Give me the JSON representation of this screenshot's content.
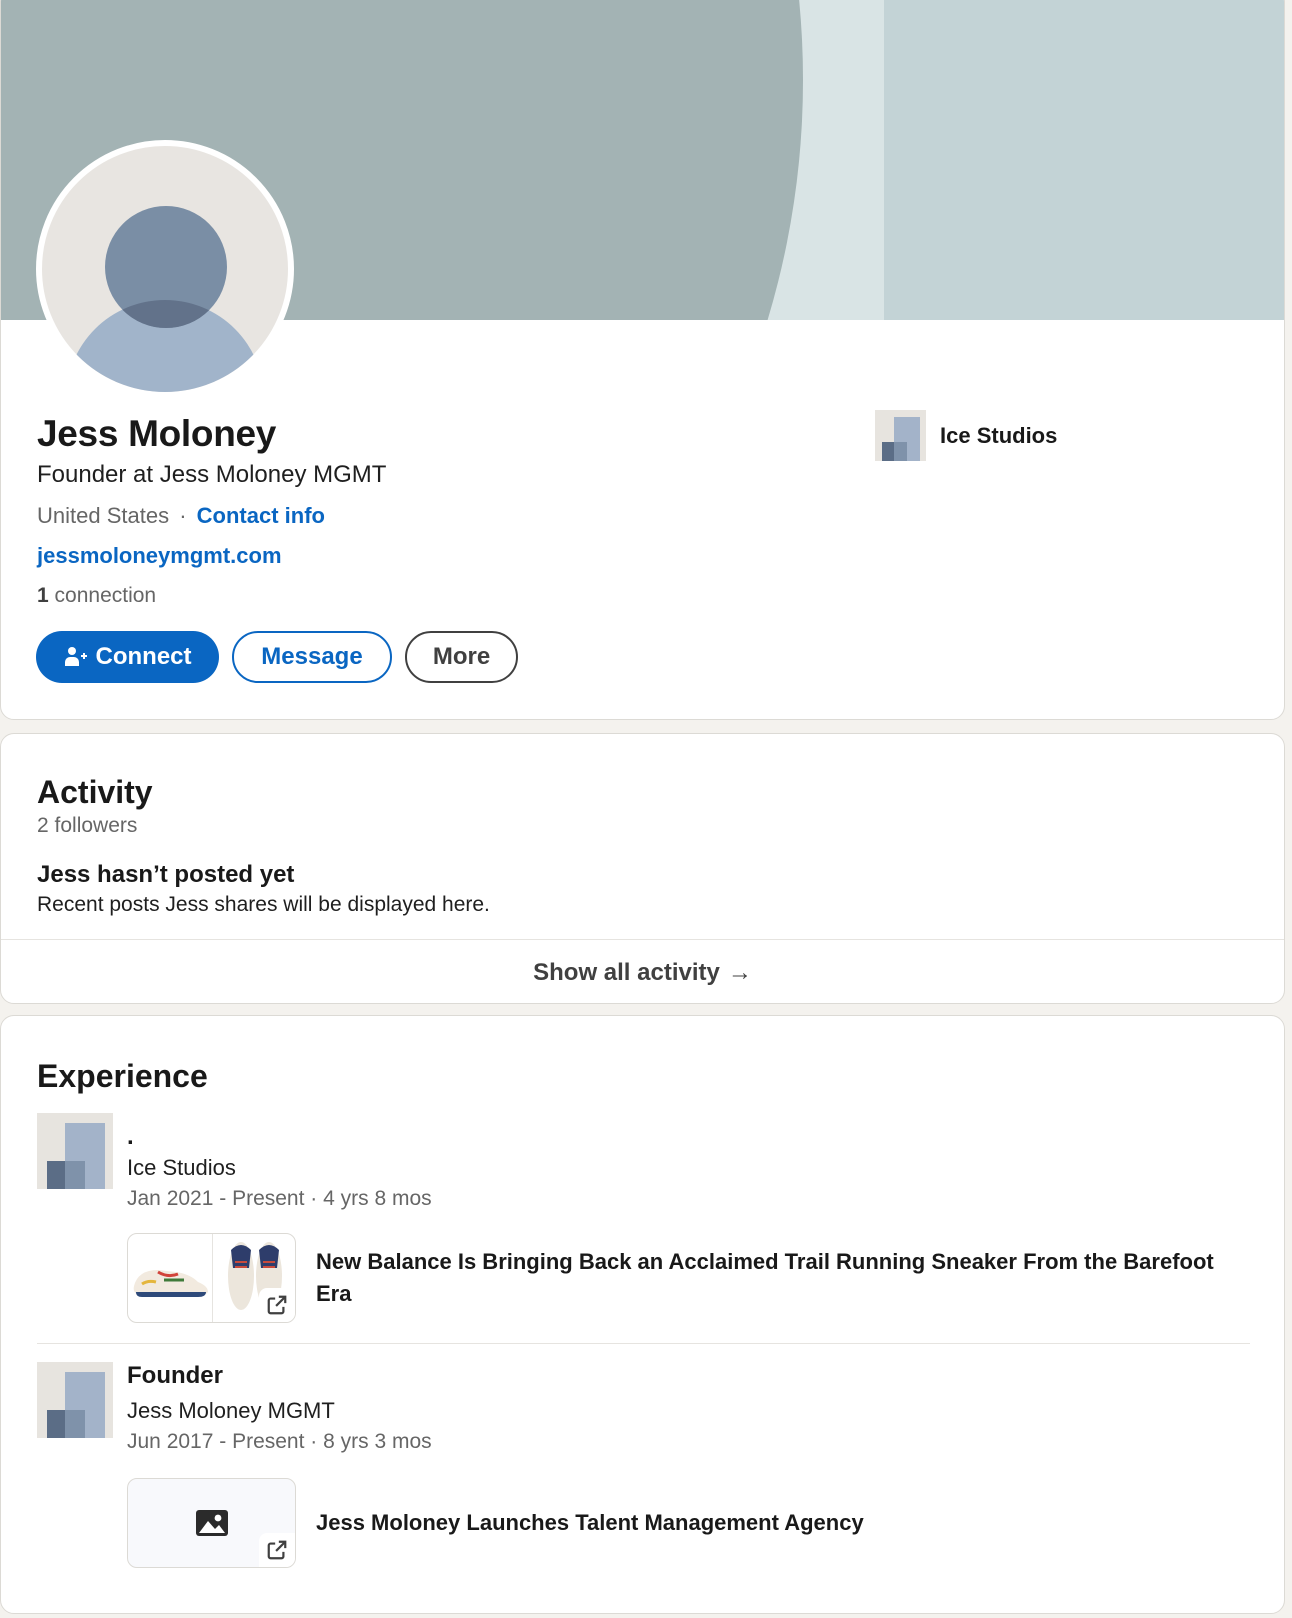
{
  "profile": {
    "name": "Jess Moloney",
    "headline": "Founder at Jess Moloney MGMT",
    "location": "United States",
    "separator": "·",
    "contact_info_label": "Contact info",
    "website": "jessmoloneymgmt.com",
    "connections_count": "1",
    "connections_label": "connection",
    "current_company": "Ice Studios"
  },
  "actions": {
    "connect_label": "Connect",
    "message_label": "Message",
    "more_label": "More"
  },
  "activity": {
    "title": "Activity",
    "followers": "2 followers",
    "empty_title": "Jess hasn’t posted yet",
    "empty_subtitle": "Recent posts Jess shares will be displayed here.",
    "show_all_label": "Show all activity",
    "show_all_arrow": "→"
  },
  "experience": {
    "title": "Experience",
    "items": [
      {
        "title": ".",
        "company": "Ice Studios",
        "dates": "Jan 2021 - Present · 4 yrs 8 mos",
        "media_title": "New Balance Is Bringing Back an Acclaimed Trail Running Sneaker From the Barefoot Era"
      },
      {
        "title": "Founder",
        "company": "Jess Moloney MGMT",
        "dates": "Jun 2017 - Present · 8 yrs 3 mos",
        "media_title": "Jess Moloney Launches Talent Management Agency"
      }
    ]
  },
  "colors": {
    "brand_blue": "#0a66c2",
    "page_bg": "#f4f2ee",
    "banner_arc": "#a3b3b4",
    "banner_right": "#c3d3d6"
  },
  "icons": {
    "connect": "person-add-icon",
    "external_link": "external-link-icon",
    "image_placeholder": "image-icon",
    "arrow": "arrow-right-icon"
  }
}
